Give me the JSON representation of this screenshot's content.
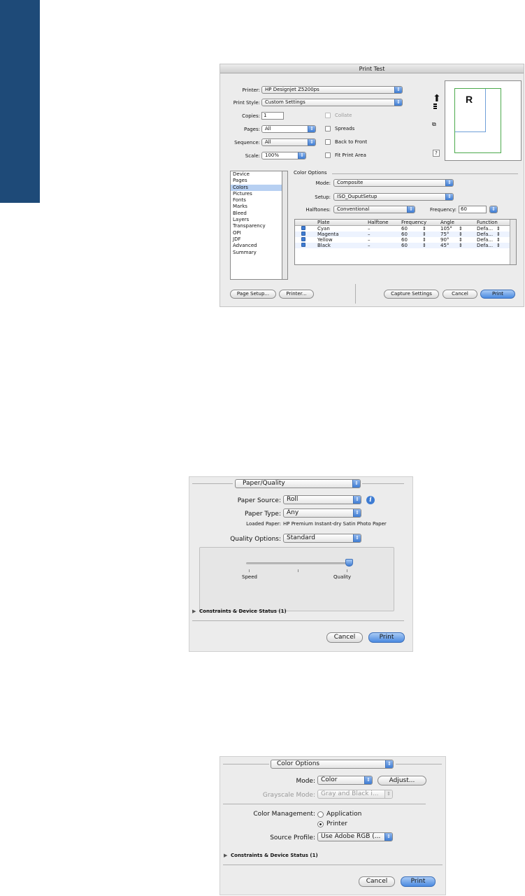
{
  "print_test": {
    "title": "Print Test",
    "printer_label": "Printer:",
    "printer_value": "HP Designjet Z5200ps",
    "print_style_label": "Print Style:",
    "print_style_value": "Custom Settings",
    "copies_label": "Copies:",
    "copies_value": "1",
    "collate_label": "Collate",
    "pages_label": "Pages:",
    "pages_value": "All",
    "spreads_label": "Spreads",
    "sequence_label": "Sequence:",
    "sequence_value": "All",
    "back_to_front_label": "Back to Front",
    "scale_label": "Scale:",
    "scale_value": "100%",
    "fit_print_area_label": "Fit Print Area",
    "preview_letter": "R",
    "help_label": "?",
    "categories": [
      "Device",
      "Pages",
      "Colors",
      "Pictures",
      "Fonts",
      "Marks",
      "Bleed",
      "Layers",
      "Transparency",
      "OPI",
      "JDF",
      "Advanced",
      "Summary"
    ],
    "selected_category": "Colors",
    "color_options_header": "Color Options",
    "mode_label": "Mode:",
    "mode_value": "Composite",
    "setup_label": "Setup:",
    "setup_value": "ISO_OuputSetup",
    "halftones_label": "Halftones:",
    "halftones_value": "Conventional",
    "frequency_label": "Frequency:",
    "frequency_value": "60",
    "table_headers": [
      "Plate",
      "Halftone",
      "Frequency",
      "Angle",
      "Function"
    ],
    "plates": [
      {
        "plate": "Cyan",
        "halftone": "–",
        "frequency": "60",
        "angle": "105°",
        "function": "Defa..."
      },
      {
        "plate": "Magenta",
        "halftone": "–",
        "frequency": "60",
        "angle": "75°",
        "function": "Defa..."
      },
      {
        "plate": "Yellow",
        "halftone": "–",
        "frequency": "60",
        "angle": "90°",
        "function": "Defa..."
      },
      {
        "plate": "Black",
        "halftone": "–",
        "frequency": "60",
        "angle": "45°",
        "function": "Defa..."
      }
    ],
    "page_setup_button": "Page Setup...",
    "printer_button": "Printer...",
    "capture_settings_button": "Capture Settings",
    "cancel_button": "Cancel",
    "print_button": "Print"
  },
  "paper_quality": {
    "panel_value": "Paper/Quality",
    "paper_source_label": "Paper Source:",
    "paper_source_value": "Roll",
    "paper_type_label": "Paper Type:",
    "paper_type_value": "Any",
    "loaded_paper_label": "Loaded Paper:",
    "loaded_paper_value": "HP Premium Instant-dry Satin Photo Paper",
    "quality_options_label": "Quality Options:",
    "quality_options_value": "Standard",
    "speed_label": "Speed",
    "quality_label": "Quality",
    "slider_level": 1.0,
    "constraints_label": "Constraints & Device Status (1)",
    "cancel_button": "Cancel",
    "print_button": "Print"
  },
  "color_options": {
    "panel_value": "Color Options",
    "mode_label": "Mode:",
    "mode_value": "Color",
    "adjust_button": "Adjust...",
    "grayscale_mode_label": "Grayscale Mode:",
    "grayscale_mode_value": "Gray and Black i...",
    "color_management_label": "Color Management:",
    "application_label": "Application",
    "printer_label": "Printer",
    "selected_management": "Printer",
    "source_profile_label": "Source Profile:",
    "source_profile_value": "Use Adobe RGB (...",
    "constraints_label": "Constraints & Device Status (1)",
    "cancel_button": "Cancel",
    "print_button": "Print"
  }
}
